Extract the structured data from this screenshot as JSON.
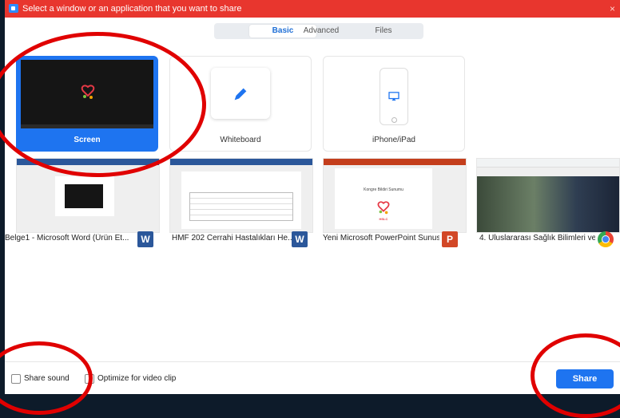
{
  "window": {
    "title": "Select a window or an application that you want to share",
    "close_label": "×"
  },
  "tabs": [
    {
      "label": "Basic",
      "active": true
    },
    {
      "label": "Advanced",
      "active": false
    },
    {
      "label": "Files",
      "active": false
    }
  ],
  "basic_options": [
    {
      "label": "Screen",
      "selected": true,
      "icon": "monitor-icon"
    },
    {
      "label": "Whiteboard",
      "selected": false,
      "icon": "pencil-icon"
    },
    {
      "label": "iPhone/iPad",
      "selected": false,
      "icon": "airplay-icon"
    }
  ],
  "apps": [
    {
      "label": "Belge1 - Microsoft Word (Ürün Et...",
      "icon": "word-icon",
      "icon_text": "W"
    },
    {
      "label": "HMF 202 Cerrahi Hastalıkları He...",
      "icon": "word-icon",
      "icon_text": "W"
    },
    {
      "label": "Yeni Microsoft PowerPoint Sunus...",
      "icon": "powerpoint-icon",
      "icon_text": "P"
    },
    {
      "label": "4. Uluslararası Sağlık Bilimleri ve ...",
      "icon": "chrome-icon",
      "icon_text": ""
    }
  ],
  "thumb_texts": {
    "kongre_title": "Kongre Bildiri Sunumu",
    "logo_text": "HSLC"
  },
  "footer": {
    "share_sound": "Share sound",
    "optimize": "Optimize for video clip",
    "share_button": "Share"
  },
  "colors": {
    "titlebar": "#e8362e",
    "accent": "#1e74f0",
    "annotation": "#e00000"
  }
}
